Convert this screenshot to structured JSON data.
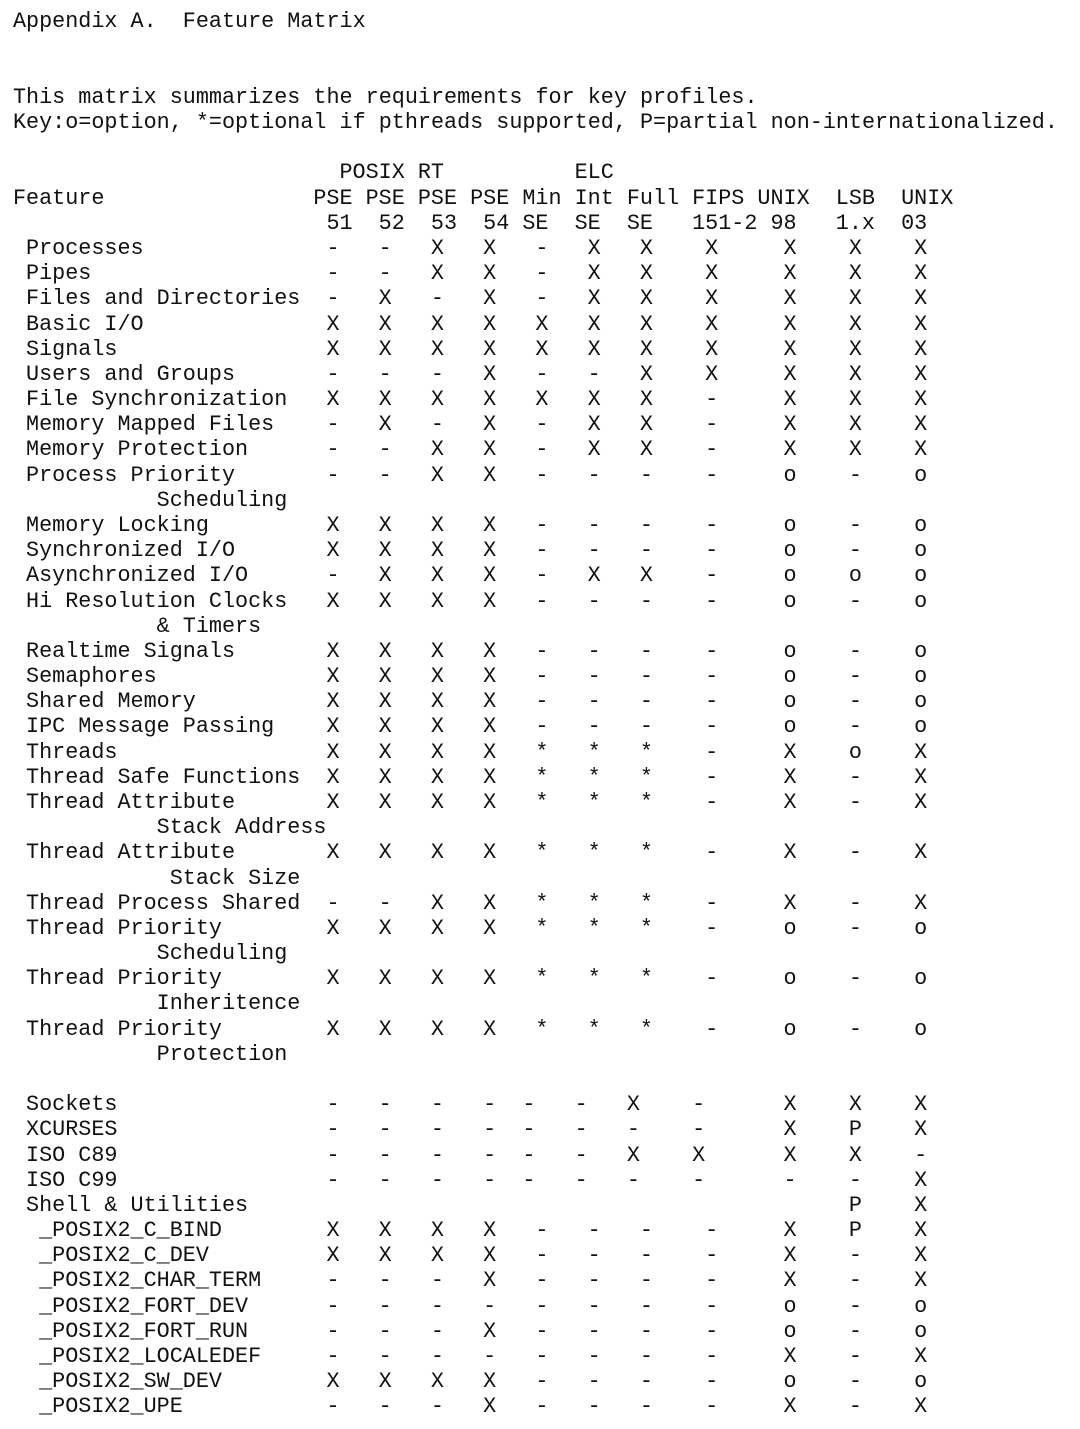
{
  "title": "Appendix A.  Feature Matrix",
  "intro": [
    "This matrix summarizes the requirements for key profiles.",
    "Key:o=option, *=optional if pthreads supported, P=partial non-internationalized."
  ],
  "header": {
    "group_labels": [
      "POSIX RT",
      "ELC"
    ],
    "feature_label": "Feature",
    "columns": [
      {
        "top": "PSE",
        "bottom": "51"
      },
      {
        "top": "PSE",
        "bottom": "52"
      },
      {
        "top": "PSE",
        "bottom": "53"
      },
      {
        "top": "PSE",
        "bottom": "54"
      },
      {
        "top": "Min",
        "bottom": "SE"
      },
      {
        "top": "Int",
        "bottom": "SE"
      },
      {
        "top": "Full",
        "bottom": "SE"
      },
      {
        "top": "FIPS",
        "bottom": "151-2"
      },
      {
        "top": "UNIX",
        "bottom": "98"
      },
      {
        "top": "LSB",
        "bottom": "1.x"
      },
      {
        "top": "UNIX",
        "bottom": "03"
      }
    ]
  },
  "groups": [
    {
      "rows": [
        {
          "feature": "Processes",
          "cells": [
            "-",
            "-",
            "X",
            "X",
            "-",
            "X",
            "X",
            "X",
            "X",
            "X",
            "X"
          ]
        },
        {
          "feature": "Pipes",
          "cells": [
            "-",
            "-",
            "X",
            "X",
            "-",
            "X",
            "X",
            "X",
            "X",
            "X",
            "X"
          ]
        },
        {
          "feature": "Files and Directories",
          "cells": [
            "-",
            "X",
            "-",
            "X",
            "-",
            "X",
            "X",
            "X",
            "X",
            "X",
            "X"
          ]
        },
        {
          "feature": "Basic I/O",
          "cells": [
            "X",
            "X",
            "X",
            "X",
            "X",
            "X",
            "X",
            "X",
            "X",
            "X",
            "X"
          ]
        },
        {
          "feature": "Signals",
          "cells": [
            "X",
            "X",
            "X",
            "X",
            "X",
            "X",
            "X",
            "X",
            "X",
            "X",
            "X"
          ]
        },
        {
          "feature": "Users and Groups",
          "cells": [
            "-",
            "-",
            "-",
            "X",
            "-",
            "-",
            "X",
            "X",
            "X",
            "X",
            "X"
          ]
        },
        {
          "feature": "File Synchronization",
          "cells": [
            "X",
            "X",
            "X",
            "X",
            "X",
            "X",
            "X",
            "-",
            "X",
            "X",
            "X"
          ]
        },
        {
          "feature": "Memory Mapped Files",
          "cells": [
            "-",
            "X",
            "-",
            "X",
            "-",
            "X",
            "X",
            "-",
            "X",
            "X",
            "X"
          ]
        },
        {
          "feature": "Memory Protection",
          "cells": [
            "-",
            "-",
            "X",
            "X",
            "-",
            "X",
            "X",
            "-",
            "X",
            "X",
            "X"
          ]
        },
        {
          "feature": "Process Priority",
          "continuation": "Scheduling",
          "cells": [
            "-",
            "-",
            "X",
            "X",
            "-",
            "-",
            "-",
            "-",
            "o",
            "-",
            "o"
          ]
        },
        {
          "feature": "Memory Locking",
          "cells": [
            "X",
            "X",
            "X",
            "X",
            "-",
            "-",
            "-",
            "-",
            "o",
            "-",
            "o"
          ]
        },
        {
          "feature": "Synchronized I/O",
          "cells": [
            "X",
            "X",
            "X",
            "X",
            "-",
            "-",
            "-",
            "-",
            "o",
            "-",
            "o"
          ]
        },
        {
          "feature": "Asynchronized I/O",
          "cells": [
            "-",
            "X",
            "X",
            "X",
            "-",
            "X",
            "X",
            "-",
            "o",
            "o",
            "o"
          ]
        },
        {
          "feature": "Hi Resolution Clocks",
          "continuation": "& Timers",
          "cells": [
            "X",
            "X",
            "X",
            "X",
            "-",
            "-",
            "-",
            "-",
            "o",
            "-",
            "o"
          ]
        },
        {
          "feature": "Realtime Signals",
          "cells": [
            "X",
            "X",
            "X",
            "X",
            "-",
            "-",
            "-",
            "-",
            "o",
            "-",
            "o"
          ]
        },
        {
          "feature": "Semaphores",
          "cells": [
            "X",
            "X",
            "X",
            "X",
            "-",
            "-",
            "-",
            "-",
            "o",
            "-",
            "o"
          ]
        },
        {
          "feature": "Shared Memory",
          "cells": [
            "X",
            "X",
            "X",
            "X",
            "-",
            "-",
            "-",
            "-",
            "o",
            "-",
            "o"
          ]
        },
        {
          "feature": "IPC Message Passing",
          "cells": [
            "X",
            "X",
            "X",
            "X",
            "-",
            "-",
            "-",
            "-",
            "o",
            "-",
            "o"
          ]
        },
        {
          "feature": "Threads",
          "cells": [
            "X",
            "X",
            "X",
            "X",
            "*",
            "*",
            "*",
            "-",
            "X",
            "o",
            "X"
          ]
        },
        {
          "feature": "Thread Safe Functions",
          "cells": [
            "X",
            "X",
            "X",
            "X",
            "*",
            "*",
            "*",
            "-",
            "X",
            "-",
            "X"
          ]
        },
        {
          "feature": "Thread Attribute",
          "continuation": "Stack Address",
          "cells": [
            "X",
            "X",
            "X",
            "X",
            "*",
            "*",
            "*",
            "-",
            "X",
            "-",
            "X"
          ]
        },
        {
          "feature": "Thread Attribute",
          "continuation": "Stack Size",
          "cells": [
            "X",
            "X",
            "X",
            "X",
            "*",
            "*",
            "*",
            "-",
            "X",
            "-",
            "X"
          ]
        },
        {
          "feature": "Thread Process Shared",
          "cells": [
            "-",
            "-",
            "X",
            "X",
            "*",
            "*",
            "*",
            "-",
            "X",
            "-",
            "X"
          ]
        },
        {
          "feature": "Thread Priority",
          "continuation": "Scheduling",
          "cells": [
            "X",
            "X",
            "X",
            "X",
            "*",
            "*",
            "*",
            "-",
            "o",
            "-",
            "o"
          ]
        },
        {
          "feature": "Thread Priority",
          "continuation": "Inheritence",
          "cells": [
            "X",
            "X",
            "X",
            "X",
            "*",
            "*",
            "*",
            "-",
            "o",
            "-",
            "o"
          ]
        },
        {
          "feature": "Thread Priority",
          "continuation": "Protection",
          "cells": [
            "X",
            "X",
            "X",
            "X",
            "*",
            "*",
            "*",
            "-",
            "o",
            "-",
            "o"
          ]
        }
      ]
    },
    {
      "rows": [
        {
          "feature": "Sockets",
          "cells": [
            "-",
            "-",
            "-",
            "-",
            "-",
            "-",
            "X",
            "-",
            "X",
            "X",
            "X"
          ]
        },
        {
          "feature": "XCURSES",
          "cells": [
            "-",
            "-",
            "-",
            "-",
            "-",
            "-",
            "-",
            "-",
            "X",
            "P",
            "X"
          ]
        },
        {
          "feature": "ISO C89",
          "cells": [
            "-",
            "-",
            "-",
            "-",
            "-",
            "-",
            "X",
            "X",
            "X",
            "X",
            "-"
          ]
        },
        {
          "feature": "ISO C99",
          "cells": [
            "-",
            "-",
            "-",
            "-",
            "-",
            "-",
            "-",
            "-",
            "-",
            "-",
            "X"
          ]
        },
        {
          "feature": "Shell & Utilities",
          "cells": [
            "",
            "",
            "",
            "",
            "",
            "",
            "",
            "",
            "",
            "P",
            "X"
          ]
        }
      ]
    },
    {
      "rows": [
        {
          "feature": "_POSIX2_C_BIND",
          "cells": [
            "X",
            "X",
            "X",
            "X",
            "-",
            "-",
            "-",
            "-",
            "X",
            "P",
            "X"
          ]
        },
        {
          "feature": "_POSIX2_C_DEV",
          "cells": [
            "X",
            "X",
            "X",
            "X",
            "-",
            "-",
            "-",
            "-",
            "X",
            "-",
            "X"
          ]
        },
        {
          "feature": "_POSIX2_CHAR_TERM",
          "cells": [
            "-",
            "-",
            "-",
            "X",
            "-",
            "-",
            "-",
            "-",
            "X",
            "-",
            "X"
          ]
        },
        {
          "feature": "_POSIX2_FORT_DEV",
          "cells": [
            "-",
            "-",
            "-",
            "-",
            "-",
            "-",
            "-",
            "-",
            "o",
            "-",
            "o"
          ]
        },
        {
          "feature": "_POSIX2_FORT_RUN",
          "cells": [
            "-",
            "-",
            "-",
            "X",
            "-",
            "-",
            "-",
            "-",
            "o",
            "-",
            "o"
          ]
        },
        {
          "feature": "_POSIX2_LOCALEDEF",
          "cells": [
            "-",
            "-",
            "-",
            "-",
            "-",
            "-",
            "-",
            "-",
            "X",
            "-",
            "X"
          ]
        },
        {
          "feature": "_POSIX2_SW_DEV",
          "cells": [
            "X",
            "X",
            "X",
            "X",
            "-",
            "-",
            "-",
            "-",
            "o",
            "-",
            "o"
          ]
        },
        {
          "feature": "_POSIX2_UPE",
          "cells": [
            "-",
            "-",
            "-",
            "X",
            "-",
            "-",
            "-",
            "-",
            "X",
            "-",
            "X"
          ]
        }
      ]
    }
  ]
}
